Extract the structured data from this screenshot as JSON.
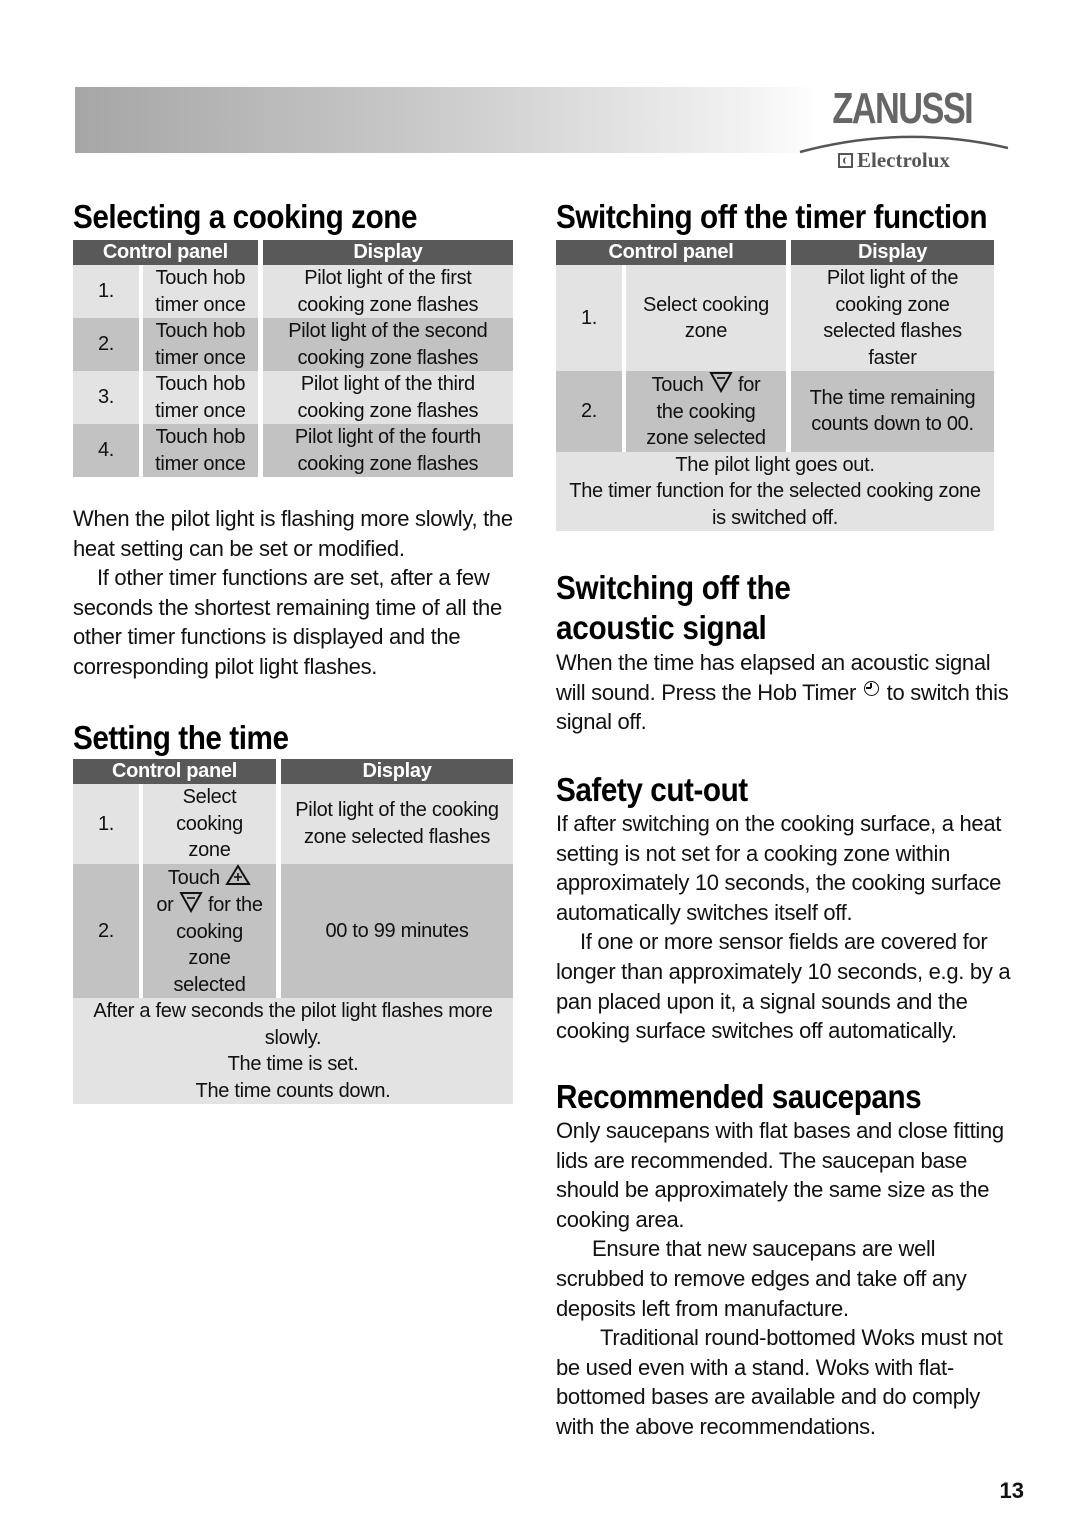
{
  "header": {
    "brand": "ZANUSSI",
    "sub_brand": "Electrolux"
  },
  "table_headers": {
    "control_panel": "Control panel",
    "display": "Display"
  },
  "selecting_zone": {
    "title": "Selecting a cooking zone",
    "rows": [
      {
        "step": "1.",
        "control": [
          "Touch hob",
          "timer once"
        ],
        "display": [
          "Pilot light of the first",
          "cooking zone flashes"
        ]
      },
      {
        "step": "2.",
        "control": [
          "Touch hob",
          "timer once"
        ],
        "display": [
          "Pilot light of the second",
          "cooking zone flashes"
        ]
      },
      {
        "step": "3.",
        "control": [
          "Touch hob",
          "timer once"
        ],
        "display": [
          "Pilot light of the third",
          "cooking zone flashes"
        ]
      },
      {
        "step": "4.",
        "control": [
          "Touch hob",
          "timer once"
        ],
        "display": [
          "Pilot light of the fourth",
          "cooking zone flashes"
        ]
      }
    ],
    "para1": "When the pilot light is flashing more slowly, the heat setting can be set or modified.",
    "para2": "If other timer functions are set, after a few seconds the shortest remaining time of all the other timer functions is displayed and the corresponding pilot light flashes."
  },
  "setting_time": {
    "title": "Setting the time",
    "row1": {
      "step": "1.",
      "control": [
        "Select",
        "cooking",
        "zone"
      ],
      "display": [
        "Pilot light of the cooking",
        "zone selected flashes"
      ]
    },
    "row2": {
      "step": "2.",
      "control_touch": "Touch",
      "control_or": "or",
      "control_for": "for the",
      "control_rest": [
        "cooking",
        "zone",
        "selected"
      ],
      "display": "00 to 99 minutes",
      "plus_icon": "plus-triangle-icon",
      "minus_icon": "minus-triangle-icon"
    },
    "footer": [
      "After a few seconds the pilot light flashes more",
      "slowly.",
      "The time is set.",
      "The time counts down."
    ]
  },
  "switch_off_timer": {
    "title": "Switching off the timer function",
    "row1": {
      "step": "1.",
      "control": [
        "Select cooking",
        "zone"
      ],
      "display": [
        "Pilot light of the",
        "cooking zone",
        "selected flashes",
        "faster"
      ]
    },
    "row2": {
      "step": "2.",
      "control_touch": "Touch",
      "control_for": "for",
      "control_rest": [
        "the cooking",
        "zone selected"
      ],
      "display": [
        "The time remaining",
        "counts down to 00."
      ],
      "minus_icon": "minus-triangle-icon"
    },
    "footer": [
      "The pilot light goes out.",
      "The timer function for the selected cooking zone",
      "is switched off."
    ]
  },
  "acoustic_signal": {
    "title": "Switching off the acoustic signal",
    "text_before": "When the time has elapsed an acoustic signal will sound.  Press the Hob Timer",
    "text_after": "to switch this signal off.",
    "icon": "clock-icon"
  },
  "safety_cutout": {
    "title": "Safety cut-out",
    "para1": "If after switching on the cooking surface, a heat setting is not set for a cooking zone within approximately 10 seconds, the cooking surface automatically switches itself off.",
    "para2": "If one or more sensor fields are covered for longer than approximately 10 seconds, e.g. by a pan placed upon it, a signal sounds and the cooking surface switches off automatically."
  },
  "saucepans": {
    "title": "Recommended saucepans",
    "para1": "Only saucepans with flat bases and close fitting lids are recommended.  The saucepan base should be approximately the same size as the cooking area.",
    "para2": "Ensure that new saucepans are well scrubbed to remove edges and take off any deposits left from manufacture.",
    "para3": "Traditional round-bottomed Woks must not be used even with a stand.  Woks with flat-bottomed bases are available and do comply with the above recommendations."
  },
  "page_number": "13"
}
